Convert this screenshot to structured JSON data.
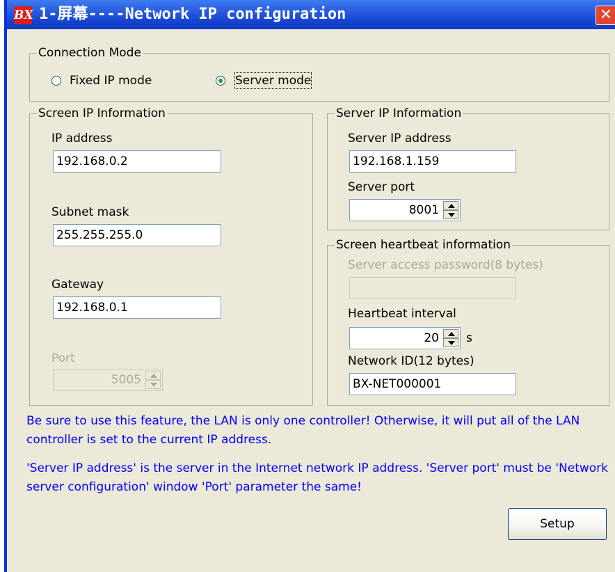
{
  "window": {
    "icon_text": "BX",
    "title": "1-屏幕----Network IP configuration",
    "close_glyph": "✕"
  },
  "connection_mode": {
    "label": "Connection Mode",
    "options": [
      {
        "label": "Fixed IP mode",
        "selected": false
      },
      {
        "label": "Server mode",
        "selected": true
      }
    ]
  },
  "screen_ip": {
    "label": "Screen IP Information",
    "ip_label": "IP address",
    "ip_value": "192.168.0.2",
    "subnet_label": "Subnet mask",
    "subnet_value": "255.255.255.0",
    "gateway_label": "Gateway",
    "gateway_value": "192.168.0.1",
    "port_label": "Port",
    "port_value": "5005"
  },
  "server_ip": {
    "label": "Server IP Information",
    "ip_label": "Server IP address",
    "ip_value": "192.168.1.159",
    "port_label": "Server port",
    "port_value": "8001"
  },
  "heartbeat": {
    "label": "Screen heartbeat information",
    "password_label": "Server access password(8 bytes)",
    "password_value": "",
    "interval_label": "Heartbeat interval",
    "interval_value": "20",
    "interval_unit": "s",
    "network_id_label": "Network ID(12 bytes)",
    "network_id_value": "BX-NET000001"
  },
  "notes": {
    "line1": "Be sure to use this feature, the LAN is only one controller! Otherwise, it will put all of the LAN controller is set to the current IP address.",
    "line2": "'Server IP address' is the server in the Internet network IP address. 'Server port' must be 'Network server configuration' window 'Port' parameter the same!"
  },
  "actions": {
    "setup_label": "Setup"
  },
  "colors": {
    "titlebar": "#2a5fe0",
    "dialog_bg": "#ece9d8",
    "note_text": "#0000ff",
    "close_button": "#e0462f"
  },
  "icons": {
    "app": "bx-logo-icon",
    "close": "close-icon"
  }
}
